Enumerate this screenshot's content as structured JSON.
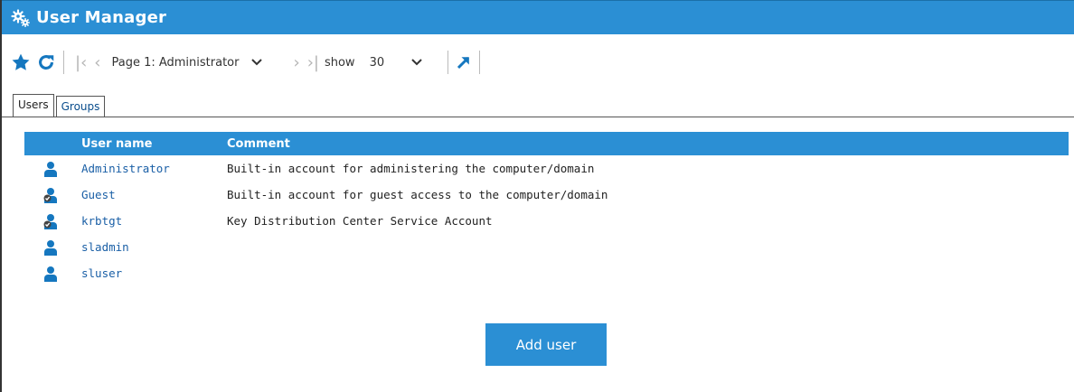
{
  "window": {
    "title": "User Manager",
    "icon": "gears-icon"
  },
  "toolbar": {
    "page_label": "Page 1: Administrator",
    "show_label": "show",
    "count_value": "30",
    "icons": [
      "star-icon",
      "refresh-icon",
      "first-page-icon",
      "prev-page-icon",
      "next-page-icon",
      "last-page-icon",
      "popout-icon"
    ]
  },
  "tabs": [
    {
      "label": "Users",
      "active": true
    },
    {
      "label": "Groups",
      "active": false
    }
  ],
  "table": {
    "headers": {
      "name": "User name",
      "comment": "Comment"
    },
    "rows": [
      {
        "name": "Administrator",
        "comment": "Built-in account for administering the computer/domain",
        "disabled": false
      },
      {
        "name": "Guest",
        "comment": "Built-in account for guest access to the computer/domain",
        "disabled": true
      },
      {
        "name": "krbtgt",
        "comment": "Key Distribution Center Service Account",
        "disabled": true
      },
      {
        "name": "sladmin",
        "comment": "",
        "disabled": false
      },
      {
        "name": "sluser",
        "comment": "",
        "disabled": false
      }
    ]
  },
  "actions": {
    "add_user_label": "Add user"
  },
  "colors": {
    "accent": "#2b8fd4",
    "link": "#1a5fa6",
    "user_icon": "#1577bf",
    "disabled_mark": "#444444"
  }
}
